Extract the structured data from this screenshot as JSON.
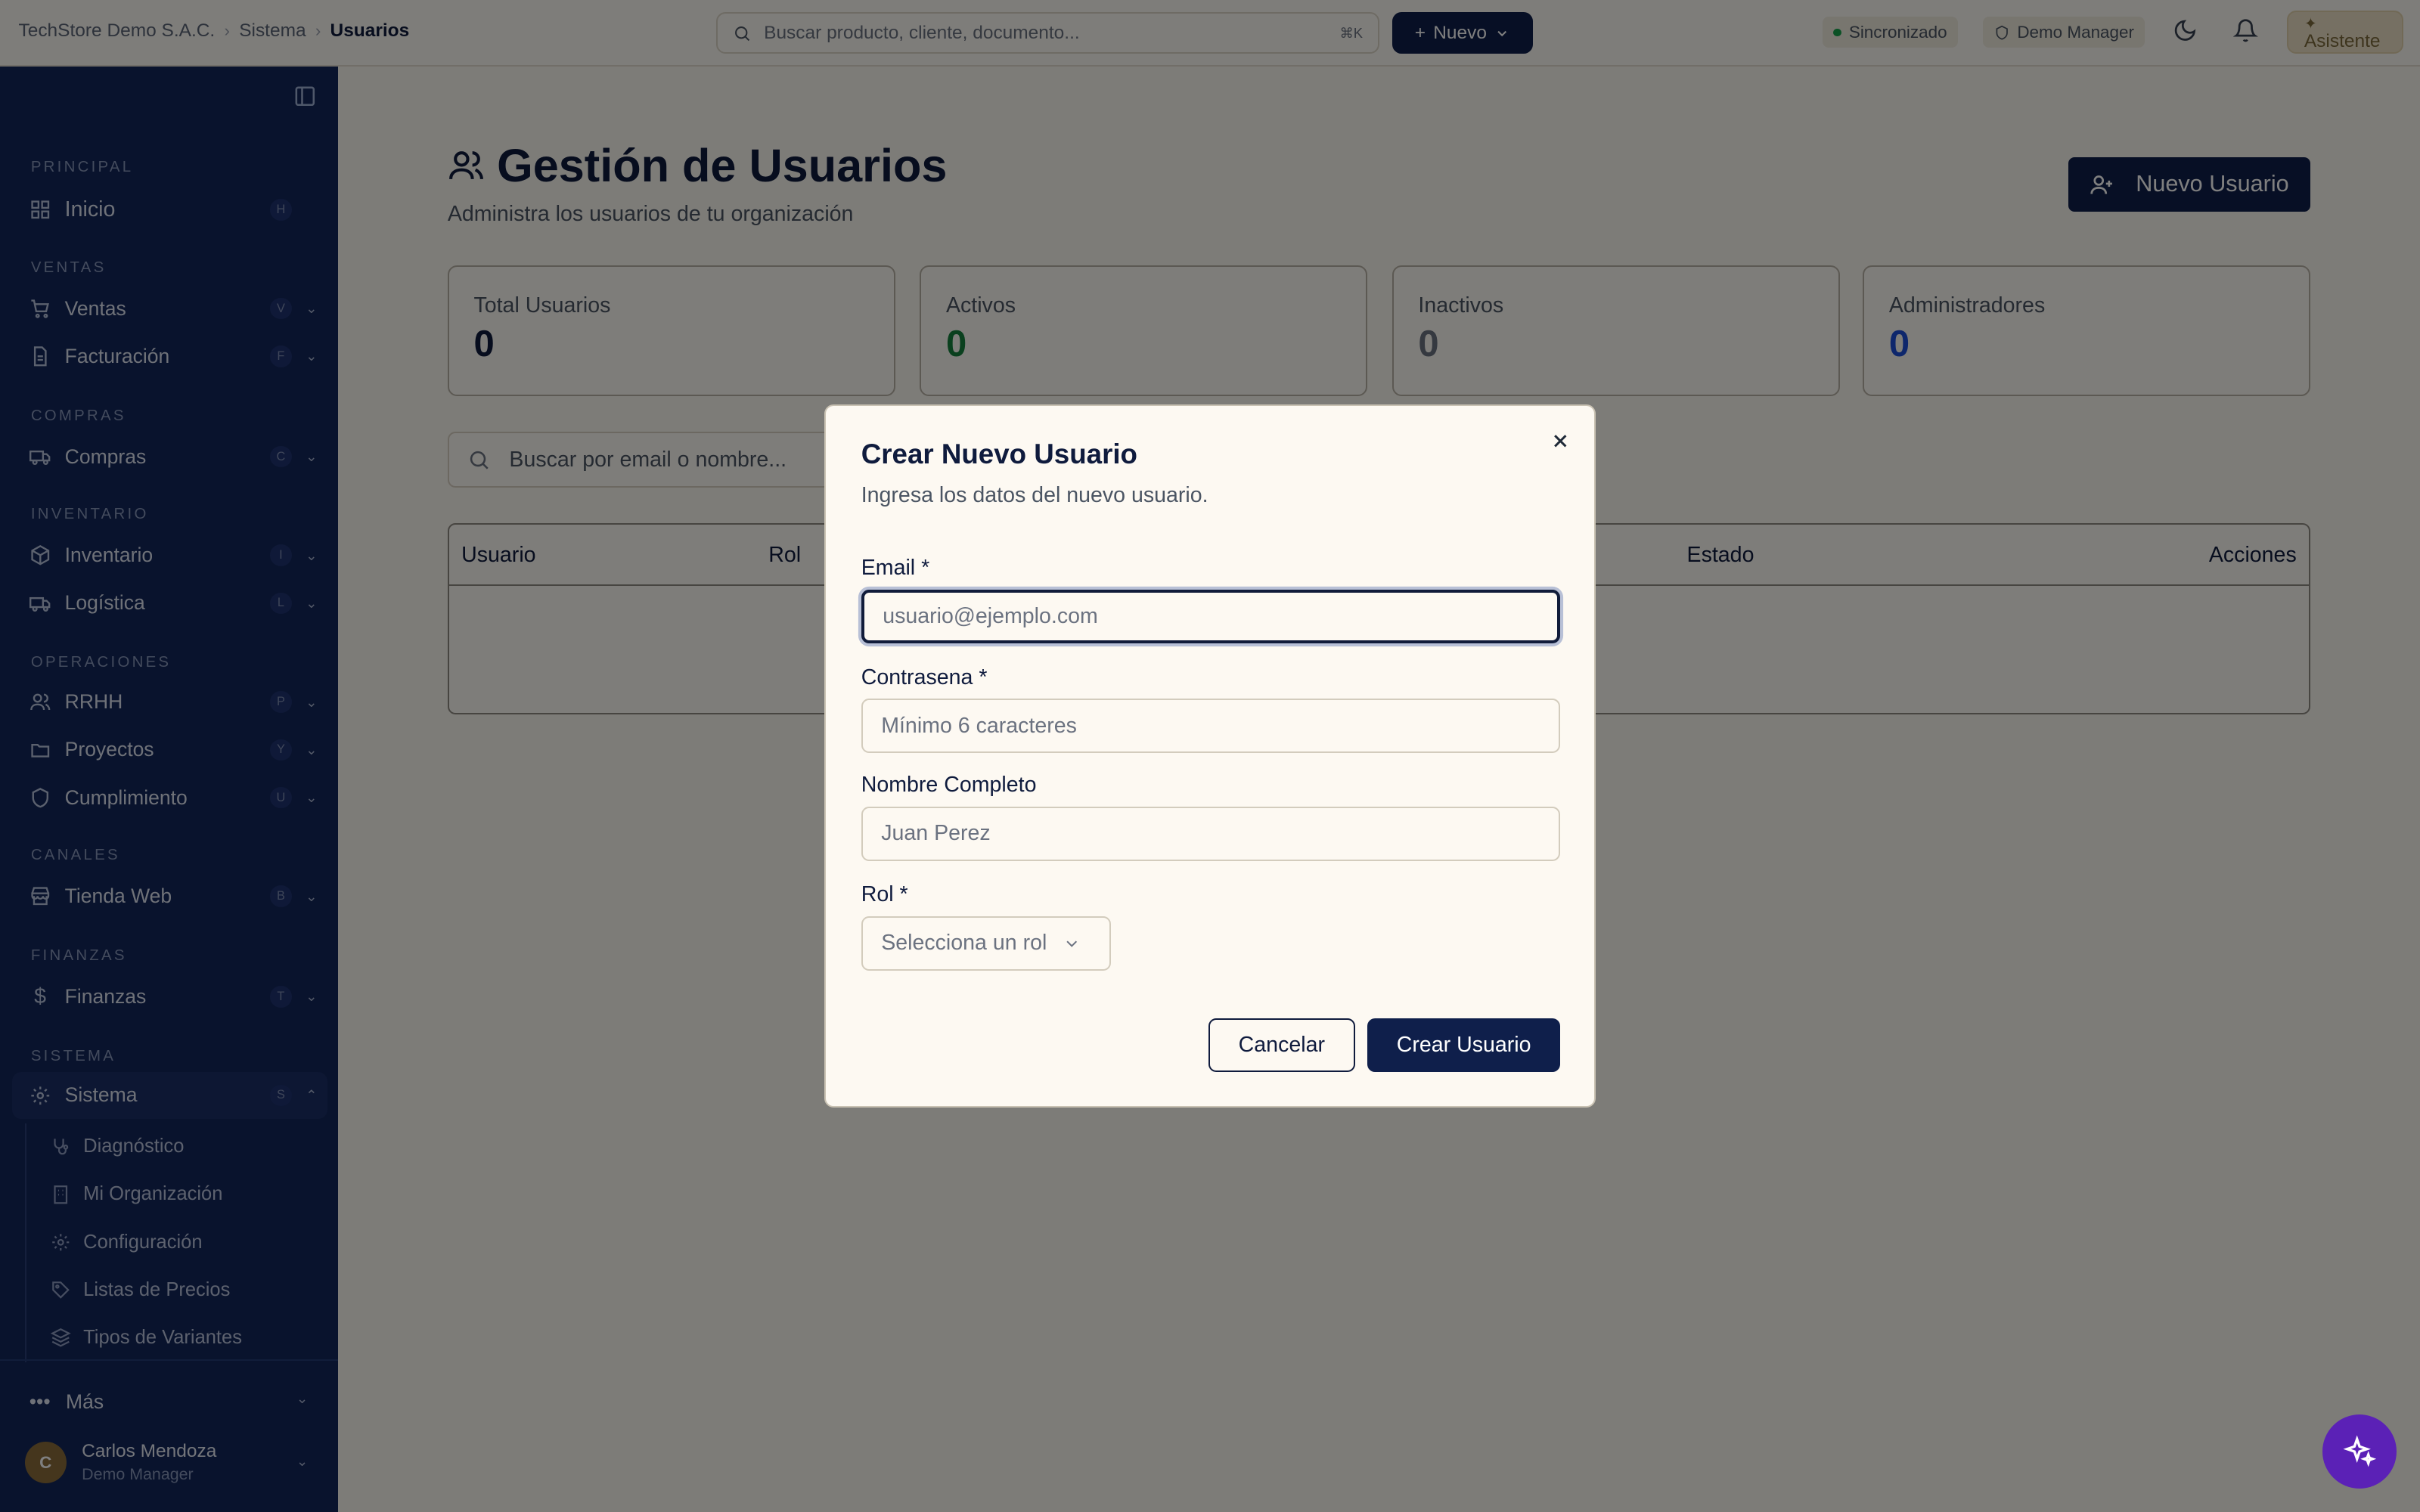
{
  "breadcrumb": {
    "org": "TechStore Demo S.A.C.",
    "section": "Sistema",
    "current": "Usuarios"
  },
  "topbar": {
    "search_placeholder": "Buscar producto, cliente, documento...",
    "search_shortcut": "⌘K",
    "new_label": "Nuevo",
    "sync_label": "Sincronizado",
    "role_label": "Demo Manager",
    "assistant_label": "Asistente"
  },
  "sidebar": {
    "sections": {
      "principal": "PRINCIPAL",
      "ventas": "VENTAS",
      "compras": "COMPRAS",
      "inventario": "INVENTARIO",
      "operaciones": "OPERACIONES",
      "canales": "CANALES",
      "finanzas": "FINANZAS",
      "sistema": "SISTEMA"
    },
    "items": {
      "inicio": {
        "label": "Inicio",
        "key": "H"
      },
      "ventas": {
        "label": "Ventas",
        "key": "V"
      },
      "facturacion": {
        "label": "Facturación",
        "key": "F"
      },
      "compras": {
        "label": "Compras",
        "key": "C"
      },
      "inventario": {
        "label": "Inventario",
        "key": "I"
      },
      "logistica": {
        "label": "Logística",
        "key": "L"
      },
      "rrhh": {
        "label": "RRHH",
        "key": "P"
      },
      "proyectos": {
        "label": "Proyectos",
        "key": "Y"
      },
      "cumplimiento": {
        "label": "Cumplimiento",
        "key": "U"
      },
      "tienda": {
        "label": "Tienda Web",
        "key": "B"
      },
      "finanzas": {
        "label": "Finanzas",
        "key": "T"
      },
      "sistema": {
        "label": "Sistema",
        "key": "S"
      }
    },
    "sub_items": {
      "diagnostico": "Diagnóstico",
      "organizacion": "Mi Organización",
      "configuracion": "Configuración",
      "precios": "Listas de Precios",
      "variantes": "Tipos de Variantes"
    },
    "more_label": "Más",
    "user": {
      "initial": "C",
      "name": "Carlos Mendoza",
      "role": "Demo Manager"
    }
  },
  "page": {
    "title": "Gestión de Usuarios",
    "subtitle": "Administra los usuarios de tu organización",
    "new_user_label": "Nuevo Usuario",
    "stats": {
      "total": {
        "label": "Total Usuarios",
        "value": "0",
        "color": "#0f1b3d"
      },
      "activos": {
        "label": "Activos",
        "value": "0",
        "color": "#15803d"
      },
      "inactivos": {
        "label": "Inactivos",
        "value": "0",
        "color": "#6b7280"
      },
      "admins": {
        "label": "Administradores",
        "value": "0",
        "color": "#1d4ed8"
      }
    },
    "search_placeholder": "Buscar por email o nombre...",
    "table_headers": {
      "usuario": "Usuario",
      "rol": "Rol",
      "estado": "Estado",
      "acciones": "Acciones"
    }
  },
  "dialog": {
    "title": "Crear Nuevo Usuario",
    "subtitle": "Ingresa los datos del nuevo usuario.",
    "email_label": "Email *",
    "email_placeholder": "usuario@ejemplo.com",
    "password_label": "Contrasena *",
    "password_placeholder": "Mínimo 6 caracteres",
    "name_label": "Nombre Completo",
    "name_placeholder": "Juan Perez",
    "role_label": "Rol *",
    "role_placeholder": "Selecciona un rol",
    "cancel_label": "Cancelar",
    "create_label": "Crear Usuario"
  },
  "colors": {
    "navy": "#0f1f4b",
    "sidebar": "#13265a",
    "fab": "#5b21b6"
  }
}
